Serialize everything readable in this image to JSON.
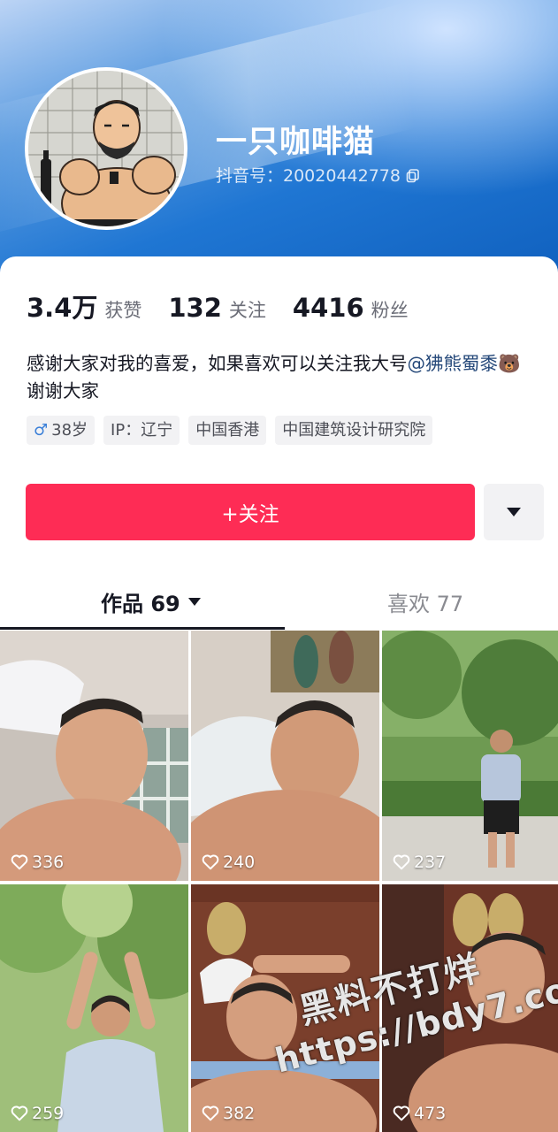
{
  "profile": {
    "nickname": "一只咖啡猫",
    "douyin_id": "抖音号：20020442778"
  },
  "stats": [
    {
      "value": "3.4万",
      "label": "获赞"
    },
    {
      "value": "132",
      "label": "关注"
    },
    {
      "value": "4416",
      "label": "粉丝"
    }
  ],
  "bio": {
    "text": "感谢大家对我的喜爱，如果喜欢可以关注我大号",
    "mention": "@狒熊蜀黍",
    "emoji": "🐻",
    "suffix": " 谢谢大家"
  },
  "tags": [
    {
      "icon": "male-icon",
      "label": "38岁"
    },
    {
      "label": "IP：辽宁"
    },
    {
      "label": "中国香港"
    },
    {
      "label": "中国建筑设计研究院"
    }
  ],
  "actions": {
    "follow_label": "+关注"
  },
  "tabs": {
    "works_label": "作品 69",
    "likes_label": "喜欢 77"
  },
  "videos": [
    {
      "likes": "336"
    },
    {
      "likes": "240"
    },
    {
      "likes": "237"
    },
    {
      "likes": "259"
    },
    {
      "likes": "382"
    },
    {
      "likes": "473"
    }
  ],
  "watermark": {
    "line1": "黑料不打烊",
    "line2": "https://bdy7.co"
  },
  "colors": {
    "accent": "#fe2c55",
    "header": "#1f76d3"
  }
}
